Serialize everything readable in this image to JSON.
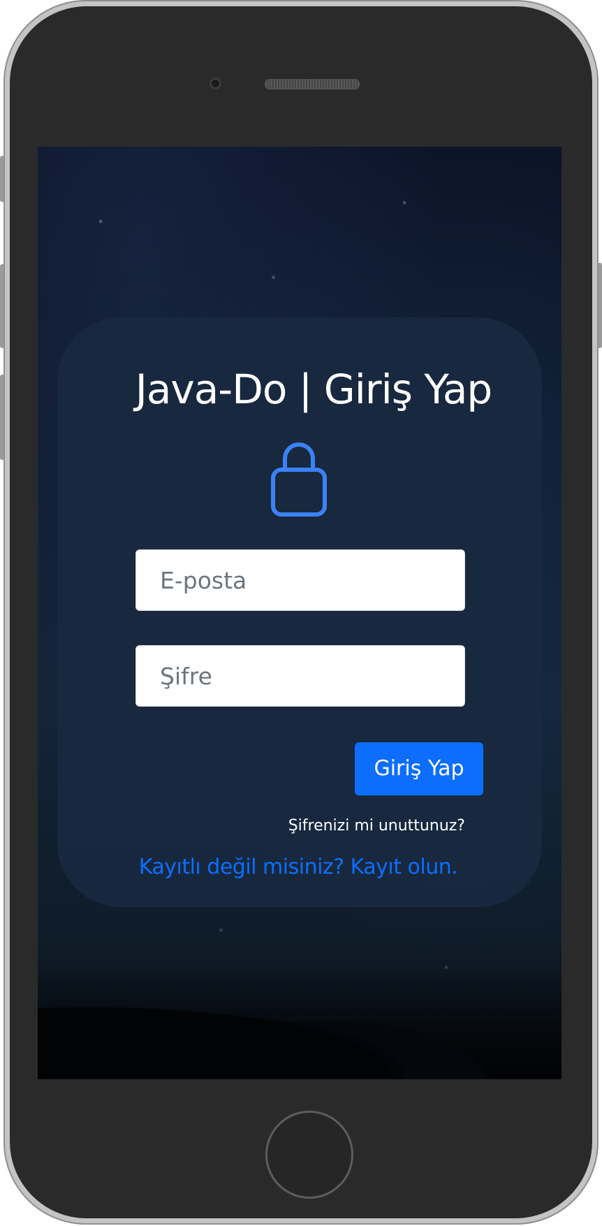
{
  "login": {
    "title": "Java-Do | Giriş Yap",
    "email_placeholder": "E-posta",
    "password_placeholder": "Şifre",
    "submit_label": "Giriş Yap",
    "forgot_password_link": "Şifrenizi mi unuttunuz?",
    "register_link": "Kayıtlı değil misiniz? Kayıt olun."
  },
  "icons": {
    "lock": "lock-icon"
  },
  "colors": {
    "accent": "#0d6efd",
    "card_background": "#182940",
    "title_text": "#ffffff"
  }
}
